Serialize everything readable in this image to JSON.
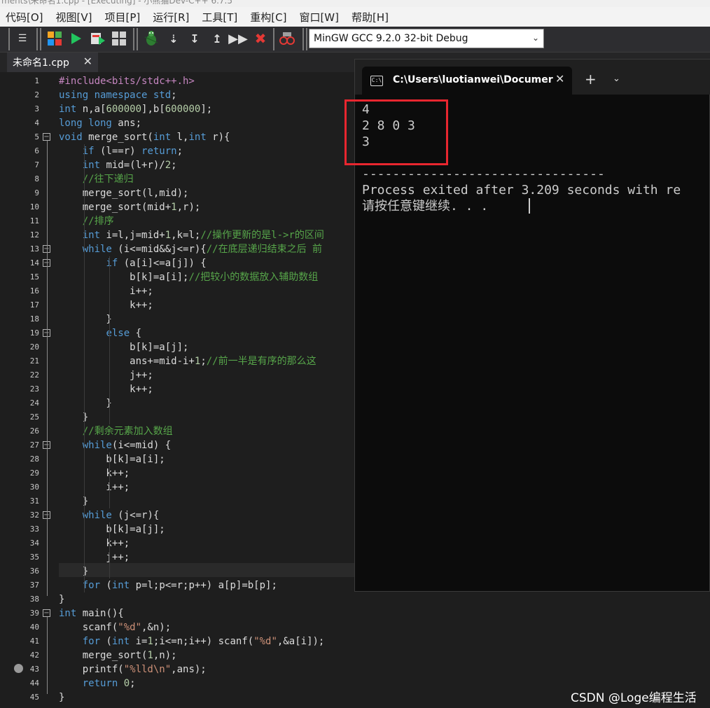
{
  "window": {
    "title": "ments\\未命名1.cpp - [Executing] - 小熊猫Dev-C++ 6.7.5"
  },
  "menu": [
    "代码[O]",
    "视图[V]",
    "项目[P]",
    "运行[R]",
    "工具[T]",
    "重构[C]",
    "窗口[W]",
    "帮助[H]"
  ],
  "toolbar": {
    "compiler": "MinGW GCC 9.2.0 32-bit Debug",
    "icons": [
      "indent-icon",
      "grid-icon",
      "run-icon",
      "compile-run-icon",
      "rebuild-icon",
      "debug-bug-icon",
      "step-icon",
      "step-into-icon",
      "step-out-icon",
      "continue-icon",
      "stop-icon",
      "profile-icon"
    ]
  },
  "editor": {
    "tab": {
      "label": "未命名1.cpp",
      "close": "✕"
    },
    "lines": [
      {
        "n": "1",
        "segs": [
          [
            "p",
            "#include<bits/stdc++.h>"
          ]
        ]
      },
      {
        "n": "2",
        "segs": [
          [
            "k",
            "using namespace"
          ],
          [
            "t",
            " "
          ],
          [
            "k",
            "std"
          ],
          [
            "t",
            ";"
          ]
        ]
      },
      {
        "n": "3",
        "segs": [
          [
            "k",
            "int"
          ],
          [
            "t",
            " n,a["
          ],
          [
            "n",
            "600000"
          ],
          [
            "t",
            "],b["
          ],
          [
            "n",
            "600000"
          ],
          [
            "t",
            "];"
          ]
        ]
      },
      {
        "n": "4",
        "segs": [
          [
            "k",
            "long long"
          ],
          [
            "t",
            " ans;"
          ]
        ]
      },
      {
        "n": "5",
        "segs": [
          [
            "k",
            "void"
          ],
          [
            "t",
            " merge_sort("
          ],
          [
            "k",
            "int"
          ],
          [
            "t",
            " l,"
          ],
          [
            "k",
            "int"
          ],
          [
            "t",
            " r){"
          ]
        ]
      },
      {
        "n": "6",
        "segs": [
          [
            "t",
            "    "
          ],
          [
            "k",
            "if"
          ],
          [
            "t",
            " (l==r) "
          ],
          [
            "k",
            "return"
          ],
          [
            "t",
            ";"
          ]
        ]
      },
      {
        "n": "7",
        "segs": [
          [
            "t",
            "    "
          ],
          [
            "k",
            "int"
          ],
          [
            "t",
            " mid=(l+r)/"
          ],
          [
            "n",
            "2"
          ],
          [
            "t",
            ";"
          ]
        ]
      },
      {
        "n": "8",
        "segs": [
          [
            "t",
            "    "
          ],
          [
            "c",
            "//往下递归"
          ]
        ]
      },
      {
        "n": "9",
        "segs": [
          [
            "t",
            "    merge_sort(l,mid);"
          ]
        ]
      },
      {
        "n": "10",
        "segs": [
          [
            "t",
            "    merge_sort(mid+"
          ],
          [
            "n",
            "1"
          ],
          [
            "t",
            ",r);"
          ]
        ]
      },
      {
        "n": "11",
        "segs": [
          [
            "t",
            "    "
          ],
          [
            "c",
            "//排序"
          ]
        ]
      },
      {
        "n": "12",
        "segs": [
          [
            "t",
            "    "
          ],
          [
            "k",
            "int"
          ],
          [
            "t",
            " i=l,j=mid+"
          ],
          [
            "n",
            "1"
          ],
          [
            "t",
            ",k=l;"
          ],
          [
            "c",
            "//操作更新的是l->r的区间"
          ]
        ]
      },
      {
        "n": "13",
        "segs": [
          [
            "t",
            "    "
          ],
          [
            "k",
            "while"
          ],
          [
            "t",
            " (i<=mid&&j<=r){"
          ],
          [
            "c",
            "//在底层递归结束之后 前"
          ]
        ]
      },
      {
        "n": "14",
        "segs": [
          [
            "t",
            "        "
          ],
          [
            "k",
            "if"
          ],
          [
            "t",
            " (a[i]<=a[j]) {"
          ]
        ]
      },
      {
        "n": "15",
        "segs": [
          [
            "t",
            "            b[k]=a[i];"
          ],
          [
            "c",
            "//把较小的数据放入辅助数组"
          ]
        ]
      },
      {
        "n": "16",
        "segs": [
          [
            "t",
            "            i++;"
          ]
        ]
      },
      {
        "n": "17",
        "segs": [
          [
            "t",
            "            k++;"
          ]
        ]
      },
      {
        "n": "18",
        "segs": [
          [
            "t",
            "        }"
          ]
        ]
      },
      {
        "n": "19",
        "segs": [
          [
            "t",
            "        "
          ],
          [
            "k",
            "else"
          ],
          [
            "t",
            " {"
          ]
        ]
      },
      {
        "n": "20",
        "segs": [
          [
            "t",
            "            b[k]=a[j];"
          ]
        ]
      },
      {
        "n": "21",
        "segs": [
          [
            "t",
            "            ans+=mid-i+"
          ],
          [
            "n",
            "1"
          ],
          [
            "t",
            ";"
          ],
          [
            "c",
            "//前一半是有序的那么这"
          ]
        ]
      },
      {
        "n": "22",
        "segs": [
          [
            "t",
            "            j++;"
          ]
        ]
      },
      {
        "n": "23",
        "segs": [
          [
            "t",
            "            k++;"
          ]
        ]
      },
      {
        "n": "24",
        "segs": [
          [
            "t",
            "        }"
          ]
        ]
      },
      {
        "n": "25",
        "segs": [
          [
            "t",
            "    }"
          ]
        ]
      },
      {
        "n": "26",
        "segs": [
          [
            "t",
            "    "
          ],
          [
            "c",
            "//剩余元素加入数组"
          ]
        ]
      },
      {
        "n": "27",
        "segs": [
          [
            "t",
            "    "
          ],
          [
            "k",
            "while"
          ],
          [
            "t",
            "(i<=mid) {"
          ]
        ]
      },
      {
        "n": "28",
        "segs": [
          [
            "t",
            "        b[k]=a[i];"
          ]
        ]
      },
      {
        "n": "29",
        "segs": [
          [
            "t",
            "        k++;"
          ]
        ]
      },
      {
        "n": "30",
        "segs": [
          [
            "t",
            "        i++;"
          ]
        ]
      },
      {
        "n": "31",
        "segs": [
          [
            "t",
            "    }"
          ]
        ]
      },
      {
        "n": "32",
        "segs": [
          [
            "t",
            "    "
          ],
          [
            "k",
            "while"
          ],
          [
            "t",
            " (j<=r){"
          ]
        ]
      },
      {
        "n": "33",
        "segs": [
          [
            "t",
            "        b[k]=a[j];"
          ]
        ]
      },
      {
        "n": "34",
        "segs": [
          [
            "t",
            "        k++;"
          ]
        ]
      },
      {
        "n": "35",
        "segs": [
          [
            "t",
            "        j++;"
          ]
        ]
      },
      {
        "n": "36",
        "segs": [
          [
            "t",
            "    }"
          ]
        ]
      },
      {
        "n": "37",
        "segs": [
          [
            "t",
            "    "
          ],
          [
            "k",
            "for"
          ],
          [
            "t",
            " ("
          ],
          [
            "k",
            "int"
          ],
          [
            "t",
            " p=l;p<=r;p++) a[p]=b[p];"
          ]
        ]
      },
      {
        "n": "38",
        "segs": [
          [
            "t",
            "}"
          ]
        ]
      },
      {
        "n": "39",
        "segs": [
          [
            "k",
            "int"
          ],
          [
            "t",
            " main(){"
          ]
        ]
      },
      {
        "n": "40",
        "segs": [
          [
            "t",
            "    scanf("
          ],
          [
            "s",
            "\"%d\""
          ],
          [
            "t",
            ",&n);"
          ]
        ]
      },
      {
        "n": "41",
        "segs": [
          [
            "t",
            "    "
          ],
          [
            "k",
            "for"
          ],
          [
            "t",
            " ("
          ],
          [
            "k",
            "int"
          ],
          [
            "t",
            " i="
          ],
          [
            "n",
            "1"
          ],
          [
            "t",
            ";i<=n;i++) scanf("
          ],
          [
            "s",
            "\"%d\""
          ],
          [
            "t",
            ",&a[i]);"
          ]
        ]
      },
      {
        "n": "42",
        "segs": [
          [
            "t",
            "    merge_sort("
          ],
          [
            "n",
            "1"
          ],
          [
            "t",
            ",n);"
          ]
        ]
      },
      {
        "n": "43",
        "segs": [
          [
            "t",
            "    printf("
          ],
          [
            "s",
            "\"%lld\\n\""
          ],
          [
            "t",
            ",ans);"
          ]
        ]
      },
      {
        "n": "44",
        "segs": [
          [
            "t",
            "    "
          ],
          [
            "k",
            "return"
          ],
          [
            "t",
            " "
          ],
          [
            "n",
            "0"
          ],
          [
            "t",
            ";"
          ]
        ]
      },
      {
        "n": "45",
        "segs": [
          [
            "t",
            "}"
          ]
        ]
      }
    ]
  },
  "terminal": {
    "title": "C:\\Users\\luotianwei\\Documer",
    "close": "✕",
    "add": "+",
    "dropdown": "⌄",
    "lines": [
      "4",
      "2 8 0 3",
      "3",
      "",
      "--------------------------------",
      "Process exited after 3.209 seconds with re",
      "请按任意键继续. . ."
    ]
  },
  "watermark": "CSDN @Loge编程生活"
}
